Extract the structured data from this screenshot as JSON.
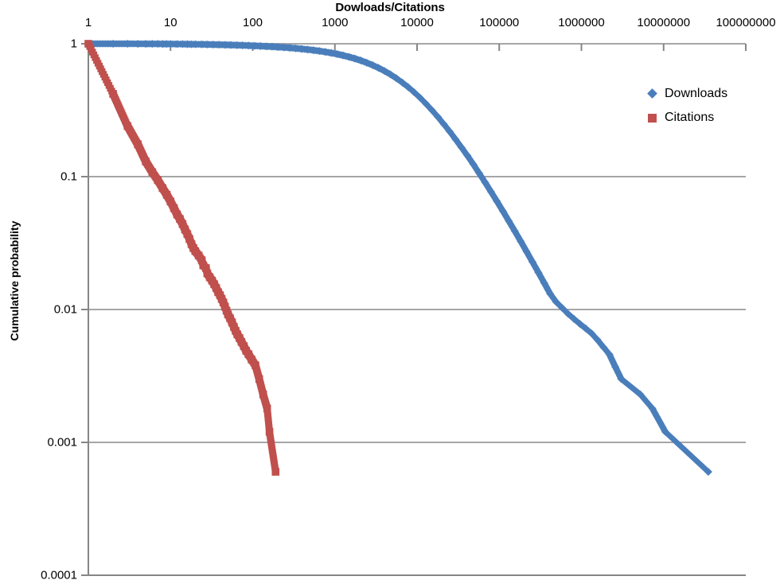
{
  "chart_data": {
    "type": "scatter",
    "title": "Dowloads/Citations",
    "xlabel": "",
    "ylabel": "Cumulative probability",
    "x_scale": "log",
    "y_scale": "log",
    "xlim": [
      1,
      100000000
    ],
    "ylim": [
      0.0001,
      1
    ],
    "grid": "horizontal",
    "legend_position": "right-top",
    "x_ticks": [
      "1",
      "10",
      "100",
      "1000",
      "10000",
      "100000",
      "1000000",
      "10000000",
      "100000000"
    ],
    "y_ticks": [
      "1",
      "0.1",
      "0.01",
      "0.001",
      "0.0001"
    ],
    "colors": {
      "downloads": "#4A7EBB",
      "citations": "#C0504D",
      "gridline": "#A6A6A6",
      "axis": "#868686"
    },
    "series": [
      {
        "name": "Downloads",
        "marker": "diamond",
        "color": "#4A7EBB",
        "points": [
          [
            1,
            1.0
          ],
          [
            2,
            1.0
          ],
          [
            3,
            1.0
          ],
          [
            4,
            0.999
          ],
          [
            5,
            0.999
          ],
          [
            6,
            0.998
          ],
          [
            7,
            0.998
          ],
          [
            8,
            0.997
          ],
          [
            9,
            0.997
          ],
          [
            10,
            0.996
          ],
          [
            12,
            0.995
          ],
          [
            14,
            0.994
          ],
          [
            16,
            0.993
          ],
          [
            18,
            0.992
          ],
          [
            20,
            0.991
          ],
          [
            24,
            0.99
          ],
          [
            28,
            0.988
          ],
          [
            33,
            0.986
          ],
          [
            39,
            0.984
          ],
          [
            46,
            0.982
          ],
          [
            54,
            0.979
          ],
          [
            64,
            0.976
          ],
          [
            75,
            0.973
          ],
          [
            89,
            0.969
          ],
          [
            105,
            0.965
          ],
          [
            124,
            0.961
          ],
          [
            146,
            0.956
          ],
          [
            172,
            0.951
          ],
          [
            203,
            0.945
          ],
          [
            240,
            0.939
          ],
          [
            283,
            0.932
          ],
          [
            334,
            0.924
          ],
          [
            394,
            0.915
          ],
          [
            465,
            0.905
          ],
          [
            549,
            0.894
          ],
          [
            648,
            0.882
          ],
          [
            765,
            0.868
          ],
          [
            903,
            0.853
          ],
          [
            1066,
            0.836
          ],
          [
            1258,
            0.817
          ],
          [
            1485,
            0.796
          ],
          [
            1753,
            0.773
          ],
          [
            2069,
            0.748
          ],
          [
            2442,
            0.72
          ],
          [
            2882,
            0.69
          ],
          [
            3402,
            0.658
          ],
          [
            4016,
            0.624
          ],
          [
            4740,
            0.588
          ],
          [
            5595,
            0.55
          ],
          [
            6604,
            0.511
          ],
          [
            7795,
            0.472
          ],
          [
            9201,
            0.432
          ],
          [
            10861,
            0.393
          ],
          [
            12820,
            0.354
          ],
          [
            15133,
            0.317
          ],
          [
            17862,
            0.282
          ],
          [
            21084,
            0.249
          ],
          [
            24887,
            0.219
          ],
          [
            29375,
            0.191
          ],
          [
            34672,
            0.166
          ],
          [
            40927,
            0.144
          ],
          [
            48309,
            0.124
          ],
          [
            57023,
            0.106
          ],
          [
            67309,
            0.0905
          ],
          [
            79450,
            0.0769
          ],
          [
            93780,
            0.0652
          ],
          [
            110696,
            0.0551
          ],
          [
            130664,
            0.0464
          ],
          [
            154239,
            0.039
          ],
          [
            182063,
            0.0327
          ],
          [
            214898,
            0.0273
          ],
          [
            253657,
            0.0228
          ],
          [
            299400,
            0.019
          ],
          [
            353391,
            0.0158
          ],
          [
            417117,
            0.0131
          ],
          [
            492337,
            0.0114
          ],
          [
            581122,
            0.0103
          ],
          [
            685937,
            0.0093
          ],
          [
            809680,
            0.0085
          ],
          [
            955723,
            0.0078
          ],
          [
            1128100,
            0.0072
          ],
          [
            1331600,
            0.0066
          ],
          [
            1571700,
            0.0059
          ],
          [
            1855200,
            0.0052
          ],
          [
            2189800,
            0.0046
          ],
          [
            2584800,
            0.0037
          ],
          [
            3051000,
            0.003
          ],
          [
            5200000,
            0.0023
          ],
          [
            7300000,
            0.0018
          ],
          [
            10500000,
            0.0012
          ],
          [
            35000000,
            0.0006
          ]
        ]
      },
      {
        "name": "Citations",
        "marker": "square",
        "color": "#C0504D",
        "points": [
          [
            1,
            1.0
          ],
          [
            2,
            0.42
          ],
          [
            3,
            0.24
          ],
          [
            4,
            0.175
          ],
          [
            5,
            0.13
          ],
          [
            6,
            0.108
          ],
          [
            7,
            0.094
          ],
          [
            8,
            0.082
          ],
          [
            9,
            0.073
          ],
          [
            10,
            0.065
          ],
          [
            11,
            0.058
          ],
          [
            12,
            0.052
          ],
          [
            13,
            0.048
          ],
          [
            14,
            0.044
          ],
          [
            15,
            0.04
          ],
          [
            16,
            0.037
          ],
          [
            17,
            0.034
          ],
          [
            18,
            0.031
          ],
          [
            19,
            0.029
          ],
          [
            20,
            0.0275
          ],
          [
            22,
            0.0255
          ],
          [
            24,
            0.0235
          ],
          [
            25,
            0.0215
          ],
          [
            27,
            0.0205
          ],
          [
            28,
            0.0187
          ],
          [
            30,
            0.0175
          ],
          [
            32,
            0.0165
          ],
          [
            34,
            0.0155
          ],
          [
            36,
            0.0145
          ],
          [
            38,
            0.0135
          ],
          [
            40,
            0.0128
          ],
          [
            42,
            0.012
          ],
          [
            44,
            0.0113
          ],
          [
            46,
            0.0105
          ],
          [
            48,
            0.0098
          ],
          [
            50,
            0.0092
          ],
          [
            53,
            0.0086
          ],
          [
            56,
            0.008
          ],
          [
            59,
            0.0074
          ],
          [
            62,
            0.0069
          ],
          [
            65,
            0.0065
          ],
          [
            69,
            0.0061
          ],
          [
            73,
            0.0057
          ],
          [
            78,
            0.0053
          ],
          [
            83,
            0.0049
          ],
          [
            89,
            0.0046
          ],
          [
            97,
            0.0042
          ],
          [
            108,
            0.0038
          ],
          [
            120,
            0.003
          ],
          [
            134,
            0.0023
          ],
          [
            150,
            0.0018
          ],
          [
            160,
            0.0012
          ],
          [
            190,
            0.0006
          ]
        ]
      }
    ]
  },
  "legend": {
    "items": [
      {
        "label": "Downloads",
        "marker": "diamond",
        "color": "#4A7EBB"
      },
      {
        "label": "Citations",
        "marker": "square",
        "color": "#C0504D"
      }
    ]
  }
}
